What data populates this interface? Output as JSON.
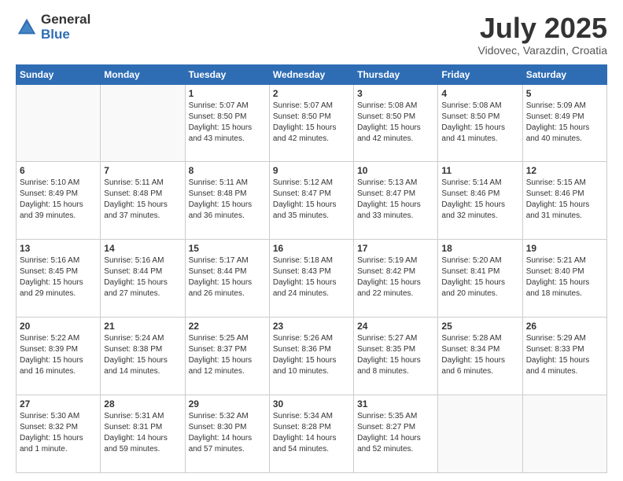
{
  "logo": {
    "general": "General",
    "blue": "Blue"
  },
  "title": "July 2025",
  "location": "Vidovec, Varazdin, Croatia",
  "headers": [
    "Sunday",
    "Monday",
    "Tuesday",
    "Wednesday",
    "Thursday",
    "Friday",
    "Saturday"
  ],
  "weeks": [
    [
      {
        "day": "",
        "sunrise": "",
        "sunset": "",
        "daylight": ""
      },
      {
        "day": "",
        "sunrise": "",
        "sunset": "",
        "daylight": ""
      },
      {
        "day": "1",
        "sunrise": "Sunrise: 5:07 AM",
        "sunset": "Sunset: 8:50 PM",
        "daylight": "Daylight: 15 hours and 43 minutes."
      },
      {
        "day": "2",
        "sunrise": "Sunrise: 5:07 AM",
        "sunset": "Sunset: 8:50 PM",
        "daylight": "Daylight: 15 hours and 42 minutes."
      },
      {
        "day": "3",
        "sunrise": "Sunrise: 5:08 AM",
        "sunset": "Sunset: 8:50 PM",
        "daylight": "Daylight: 15 hours and 42 minutes."
      },
      {
        "day": "4",
        "sunrise": "Sunrise: 5:08 AM",
        "sunset": "Sunset: 8:50 PM",
        "daylight": "Daylight: 15 hours and 41 minutes."
      },
      {
        "day": "5",
        "sunrise": "Sunrise: 5:09 AM",
        "sunset": "Sunset: 8:49 PM",
        "daylight": "Daylight: 15 hours and 40 minutes."
      }
    ],
    [
      {
        "day": "6",
        "sunrise": "Sunrise: 5:10 AM",
        "sunset": "Sunset: 8:49 PM",
        "daylight": "Daylight: 15 hours and 39 minutes."
      },
      {
        "day": "7",
        "sunrise": "Sunrise: 5:11 AM",
        "sunset": "Sunset: 8:48 PM",
        "daylight": "Daylight: 15 hours and 37 minutes."
      },
      {
        "day": "8",
        "sunrise": "Sunrise: 5:11 AM",
        "sunset": "Sunset: 8:48 PM",
        "daylight": "Daylight: 15 hours and 36 minutes."
      },
      {
        "day": "9",
        "sunrise": "Sunrise: 5:12 AM",
        "sunset": "Sunset: 8:47 PM",
        "daylight": "Daylight: 15 hours and 35 minutes."
      },
      {
        "day": "10",
        "sunrise": "Sunrise: 5:13 AM",
        "sunset": "Sunset: 8:47 PM",
        "daylight": "Daylight: 15 hours and 33 minutes."
      },
      {
        "day": "11",
        "sunrise": "Sunrise: 5:14 AM",
        "sunset": "Sunset: 8:46 PM",
        "daylight": "Daylight: 15 hours and 32 minutes."
      },
      {
        "day": "12",
        "sunrise": "Sunrise: 5:15 AM",
        "sunset": "Sunset: 8:46 PM",
        "daylight": "Daylight: 15 hours and 31 minutes."
      }
    ],
    [
      {
        "day": "13",
        "sunrise": "Sunrise: 5:16 AM",
        "sunset": "Sunset: 8:45 PM",
        "daylight": "Daylight: 15 hours and 29 minutes."
      },
      {
        "day": "14",
        "sunrise": "Sunrise: 5:16 AM",
        "sunset": "Sunset: 8:44 PM",
        "daylight": "Daylight: 15 hours and 27 minutes."
      },
      {
        "day": "15",
        "sunrise": "Sunrise: 5:17 AM",
        "sunset": "Sunset: 8:44 PM",
        "daylight": "Daylight: 15 hours and 26 minutes."
      },
      {
        "day": "16",
        "sunrise": "Sunrise: 5:18 AM",
        "sunset": "Sunset: 8:43 PM",
        "daylight": "Daylight: 15 hours and 24 minutes."
      },
      {
        "day": "17",
        "sunrise": "Sunrise: 5:19 AM",
        "sunset": "Sunset: 8:42 PM",
        "daylight": "Daylight: 15 hours and 22 minutes."
      },
      {
        "day": "18",
        "sunrise": "Sunrise: 5:20 AM",
        "sunset": "Sunset: 8:41 PM",
        "daylight": "Daylight: 15 hours and 20 minutes."
      },
      {
        "day": "19",
        "sunrise": "Sunrise: 5:21 AM",
        "sunset": "Sunset: 8:40 PM",
        "daylight": "Daylight: 15 hours and 18 minutes."
      }
    ],
    [
      {
        "day": "20",
        "sunrise": "Sunrise: 5:22 AM",
        "sunset": "Sunset: 8:39 PM",
        "daylight": "Daylight: 15 hours and 16 minutes."
      },
      {
        "day": "21",
        "sunrise": "Sunrise: 5:24 AM",
        "sunset": "Sunset: 8:38 PM",
        "daylight": "Daylight: 15 hours and 14 minutes."
      },
      {
        "day": "22",
        "sunrise": "Sunrise: 5:25 AM",
        "sunset": "Sunset: 8:37 PM",
        "daylight": "Daylight: 15 hours and 12 minutes."
      },
      {
        "day": "23",
        "sunrise": "Sunrise: 5:26 AM",
        "sunset": "Sunset: 8:36 PM",
        "daylight": "Daylight: 15 hours and 10 minutes."
      },
      {
        "day": "24",
        "sunrise": "Sunrise: 5:27 AM",
        "sunset": "Sunset: 8:35 PM",
        "daylight": "Daylight: 15 hours and 8 minutes."
      },
      {
        "day": "25",
        "sunrise": "Sunrise: 5:28 AM",
        "sunset": "Sunset: 8:34 PM",
        "daylight": "Daylight: 15 hours and 6 minutes."
      },
      {
        "day": "26",
        "sunrise": "Sunrise: 5:29 AM",
        "sunset": "Sunset: 8:33 PM",
        "daylight": "Daylight: 15 hours and 4 minutes."
      }
    ],
    [
      {
        "day": "27",
        "sunrise": "Sunrise: 5:30 AM",
        "sunset": "Sunset: 8:32 PM",
        "daylight": "Daylight: 15 hours and 1 minute."
      },
      {
        "day": "28",
        "sunrise": "Sunrise: 5:31 AM",
        "sunset": "Sunset: 8:31 PM",
        "daylight": "Daylight: 14 hours and 59 minutes."
      },
      {
        "day": "29",
        "sunrise": "Sunrise: 5:32 AM",
        "sunset": "Sunset: 8:30 PM",
        "daylight": "Daylight: 14 hours and 57 minutes."
      },
      {
        "day": "30",
        "sunrise": "Sunrise: 5:34 AM",
        "sunset": "Sunset: 8:28 PM",
        "daylight": "Daylight: 14 hours and 54 minutes."
      },
      {
        "day": "31",
        "sunrise": "Sunrise: 5:35 AM",
        "sunset": "Sunset: 8:27 PM",
        "daylight": "Daylight: 14 hours and 52 minutes."
      },
      {
        "day": "",
        "sunrise": "",
        "sunset": "",
        "daylight": ""
      },
      {
        "day": "",
        "sunrise": "",
        "sunset": "",
        "daylight": ""
      }
    ]
  ]
}
